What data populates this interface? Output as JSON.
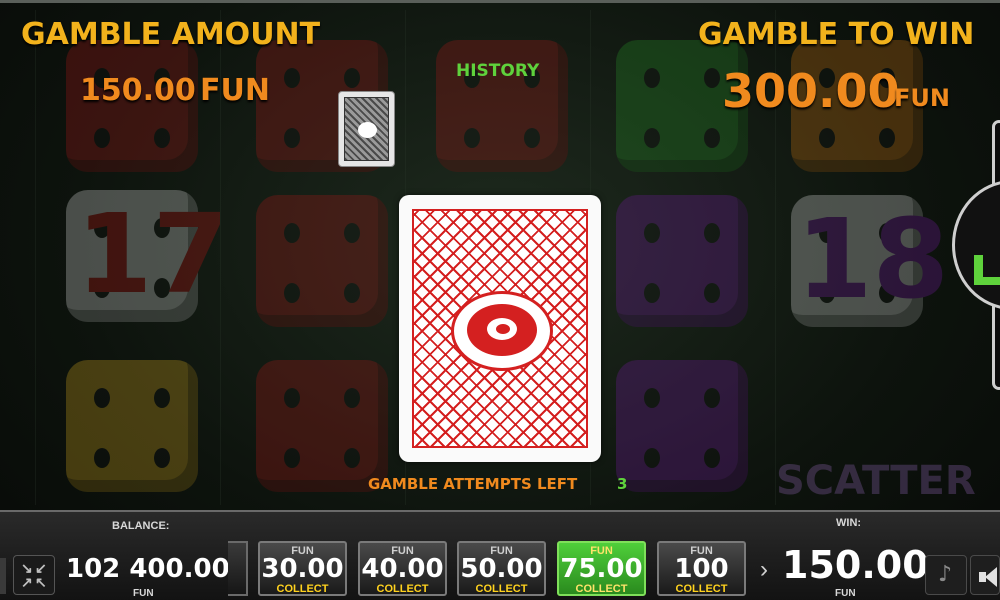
{
  "header": {
    "gamble_amount_label": "GAMBLE AMOUNT",
    "gamble_amount_value": "150.00",
    "gamble_amount_currency": "FUN",
    "gamble_to_win_label": "GAMBLE TO WIN",
    "gamble_to_win_value": "300.00",
    "gamble_to_win_currency": "FUN",
    "history_label": "HISTORY"
  },
  "card": {
    "face": "back",
    "color": "#d42020"
  },
  "attempts": {
    "label": "GAMBLE ATTEMPTS LEFT",
    "value": "3"
  },
  "reels_background": {
    "symbols": [
      "17",
      "18",
      "SCATTER"
    ]
  },
  "bottom_bar": {
    "balance_label": "BALANCE:",
    "balance_value": "102 400.00",
    "balance_currency": "FUN",
    "win_label": "WIN:",
    "win_value": "150.00",
    "win_currency": "FUN",
    "collect_buttons": [
      {
        "currency": "FUN",
        "value": "30.00",
        "label": "COLLECT",
        "active": false
      },
      {
        "currency": "FUN",
        "value": "40.00",
        "label": "COLLECT",
        "active": false
      },
      {
        "currency": "FUN",
        "value": "50.00",
        "label": "COLLECT",
        "active": false
      },
      {
        "currency": "FUN",
        "value": "75.00",
        "label": "COLLECT",
        "active": true
      },
      {
        "currency": "FUN",
        "value": "100",
        "label": "COLLECT",
        "active": false
      }
    ]
  },
  "icons": {
    "fullscreen": "collapse-arrows-icon",
    "music": "music-note-icon",
    "sound": "speaker-icon"
  }
}
